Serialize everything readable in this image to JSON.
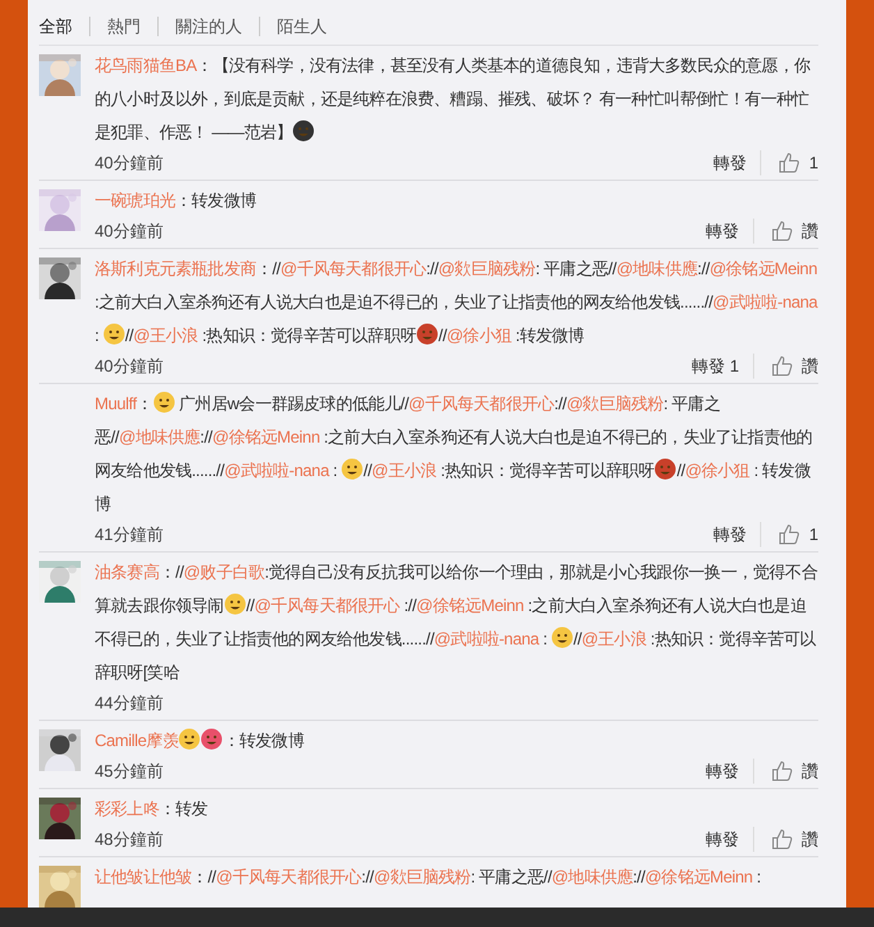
{
  "tabs": [
    {
      "label": "全部",
      "selected": true
    },
    {
      "label": "熱門",
      "selected": false
    },
    {
      "label": "關注的人",
      "selected": false
    },
    {
      "label": "陌生人",
      "selected": false
    }
  ],
  "comments": [
    {
      "avatar": {
        "kind": "picture"
      },
      "user": "花鸟雨猫鱼BA",
      "body": [
        {
          "kind": "text",
          "text": "：【没有科学，没有法律，甚至没有人类基本的道德良知，违背大多数民众的意愿，你的八小时及以外，到底是贡献，还是纯粹在浪费、糟蹋、摧残、破坏？ 有一种忙叫帮倒忙！有一种忙是犯罪、作恶！ ——范岩】"
        },
        {
          "kind": "emoji",
          "color": "#333333"
        }
      ],
      "time": "40分鐘前",
      "actions": {
        "repost": "轉發",
        "like": "1"
      }
    },
    {
      "avatar": {
        "kind": "picture"
      },
      "user": "一碗琥珀光",
      "body": [
        {
          "kind": "text",
          "text": "：转发微博"
        }
      ],
      "time": "40分鐘前",
      "actions": {
        "repost": "轉發",
        "like": "讚"
      }
    },
    {
      "avatar": {
        "kind": "picture"
      },
      "user": "洛斯利克元素瓶批发商",
      "body": [
        {
          "kind": "text",
          "text": "：//"
        },
        {
          "kind": "mention",
          "text": "@千风每天都很开心"
        },
        {
          "kind": "text",
          "text": "://"
        },
        {
          "kind": "mention",
          "text": "@欻巨脑残粉"
        },
        {
          "kind": "text",
          "text": ": 平庸之恶//"
        },
        {
          "kind": "mention",
          "text": "@地味供應"
        },
        {
          "kind": "text",
          "text": "://"
        },
        {
          "kind": "mention",
          "text": "@徐铭远Meinn"
        },
        {
          "kind": "text",
          "text": " :之前大白入室杀狗还有人说大白也是迫不得已的，失业了让指责他的网友给他发钱......//"
        },
        {
          "kind": "mention",
          "text": "@武啦啦-nana"
        },
        {
          "kind": "text",
          "text": " : "
        },
        {
          "kind": "emoji",
          "color": "#f5c542"
        },
        {
          "kind": "text",
          "text": "//"
        },
        {
          "kind": "mention",
          "text": "@王小浪"
        },
        {
          "kind": "text",
          "text": " :热知识：觉得辛苦可以辞职呀"
        },
        {
          "kind": "emoji",
          "color": "#c8402a"
        },
        {
          "kind": "text",
          "text": "//"
        },
        {
          "kind": "mention",
          "text": "@徐小狙"
        },
        {
          "kind": "text",
          "text": " :转发微博"
        }
      ],
      "time": "40分鐘前",
      "actions": {
        "repost": "轉發",
        "repost_count": "1",
        "like": "讚"
      }
    },
    {
      "user": "Muulff",
      "body": [
        {
          "kind": "text",
          "text": "："
        },
        {
          "kind": "emoji",
          "color": "#f5c542"
        },
        {
          "kind": "text",
          "text": " 广州居w会一群踢皮球的低能儿//"
        },
        {
          "kind": "mention",
          "text": "@千风每天都很开心"
        },
        {
          "kind": "text",
          "text": "://"
        },
        {
          "kind": "mention",
          "text": "@欻巨脑残粉"
        },
        {
          "kind": "text",
          "text": ": 平庸之恶//"
        },
        {
          "kind": "mention",
          "text": "@地味供應"
        },
        {
          "kind": "text",
          "text": "://"
        },
        {
          "kind": "mention",
          "text": "@徐铭远Meinn"
        },
        {
          "kind": "text",
          "text": " :之前大白入室杀狗还有人说大白也是迫不得已的，失业了让指责他的网友给他发钱......//"
        },
        {
          "kind": "mention",
          "text": "@武啦啦-nana"
        },
        {
          "kind": "text",
          "text": " : "
        },
        {
          "kind": "emoji",
          "color": "#f5c542"
        },
        {
          "kind": "text",
          "text": "//"
        },
        {
          "kind": "mention",
          "text": "@王小浪"
        },
        {
          "kind": "text",
          "text": " :热知识：觉得辛苦可以辞职呀"
        },
        {
          "kind": "emoji",
          "color": "#c8402a"
        },
        {
          "kind": "text",
          "text": "//"
        },
        {
          "kind": "mention",
          "text": "@徐小狙"
        },
        {
          "kind": "text",
          "text": " : 转发微博"
        }
      ],
      "time": "41分鐘前",
      "actions": {
        "repost": "轉發",
        "like": "1"
      }
    },
    {
      "avatar": {
        "kind": "picture"
      },
      "user": "油条赛高",
      "body": [
        {
          "kind": "text",
          "text": "：//"
        },
        {
          "kind": "mention",
          "text": "@败子白歌"
        },
        {
          "kind": "text",
          "text": ":觉得自己没有反抗我可以给你一个理由，那就是小心我跟你一换一，觉得不合算就去跟你领导闹"
        },
        {
          "kind": "emoji",
          "color": "#f5c542"
        },
        {
          "kind": "text",
          "text": "//"
        },
        {
          "kind": "mention",
          "text": "@千风每天都很开心"
        },
        {
          "kind": "text",
          "text": " ://"
        },
        {
          "kind": "mention",
          "text": "@徐铭远Meinn"
        },
        {
          "kind": "text",
          "text": " :之前大白入室杀狗还有人说大白也是迫不得已的，失业了让指责他的网友给他发钱......//"
        },
        {
          "kind": "mention",
          "text": "@武啦啦-nana"
        },
        {
          "kind": "text",
          "text": " : "
        },
        {
          "kind": "emoji",
          "color": "#f5c542"
        },
        {
          "kind": "text",
          "text": "//"
        },
        {
          "kind": "mention",
          "text": "@王小浪"
        },
        {
          "kind": "text",
          "text": " :热知识：觉得辛苦可以辞职呀[笑哈"
        }
      ],
      "time": "44分鐘前"
    },
    {
      "avatar": {
        "kind": "picture"
      },
      "user": "Camille摩羡",
      "body": [
        {
          "kind": "emoji",
          "color": "#f5c542"
        },
        {
          "kind": "emoji",
          "color": "#e8506a"
        },
        {
          "kind": "text",
          "text": "：转发微博"
        }
      ],
      "time": "45分鐘前",
      "actions": {
        "repost": "轉發",
        "like": "讚"
      }
    },
    {
      "avatar": {
        "kind": "picture"
      },
      "user": "彩彩上咚",
      "body": [
        {
          "kind": "text",
          "text": "：转发"
        }
      ],
      "time": "48分鐘前",
      "actions": {
        "repost": "轉發",
        "like": "讚"
      }
    },
    {
      "avatar": {
        "kind": "picture"
      },
      "user": "让他皱让他皱",
      "body": [
        {
          "kind": "text",
          "text": "：//"
        },
        {
          "kind": "mention",
          "text": "@千风每天都很开心"
        },
        {
          "kind": "text",
          "text": "://"
        },
        {
          "kind": "mention",
          "text": "@欻巨脑残粉"
        },
        {
          "kind": "text",
          "text": ": 平庸之恶//"
        },
        {
          "kind": "mention",
          "text": "@地味供應"
        },
        {
          "kind": "text",
          "text": "://"
        },
        {
          "kind": "mention",
          "text": "@徐铭远Meinn"
        },
        {
          "kind": "text",
          "text": " :"
        }
      ]
    }
  ]
}
